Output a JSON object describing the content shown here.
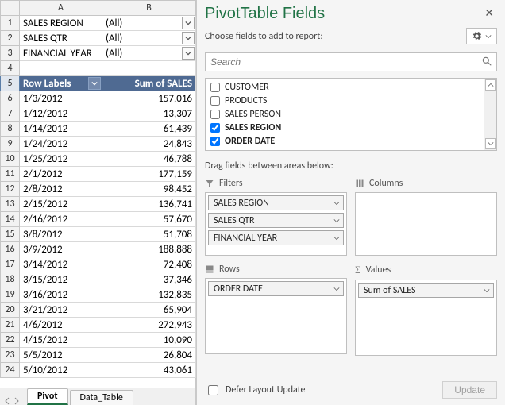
{
  "sheet": {
    "columns": [
      "A",
      "B"
    ],
    "report_filters": [
      {
        "row": 1,
        "label": "SALES REGION",
        "value": "(All)"
      },
      {
        "row": 2,
        "label": "SALES QTR",
        "value": "(All)"
      },
      {
        "row": 3,
        "label": "FINANCIAL YEAR",
        "value": "(All)"
      }
    ],
    "blank_row": 4,
    "header_row": 5,
    "header_labels": {
      "A": "Row Labels",
      "B": "Sum of SALES"
    },
    "data": [
      {
        "row": 6,
        "date": "1/3/2012",
        "value": "157,016"
      },
      {
        "row": 7,
        "date": "1/12/2012",
        "value": "13,307"
      },
      {
        "row": 8,
        "date": "1/14/2012",
        "value": "61,439"
      },
      {
        "row": 9,
        "date": "1/24/2012",
        "value": "24,843"
      },
      {
        "row": 10,
        "date": "1/25/2012",
        "value": "46,788"
      },
      {
        "row": 11,
        "date": "2/1/2012",
        "value": "177,159"
      },
      {
        "row": 12,
        "date": "2/8/2012",
        "value": "98,452"
      },
      {
        "row": 13,
        "date": "2/15/2012",
        "value": "136,741"
      },
      {
        "row": 14,
        "date": "2/16/2012",
        "value": "57,670"
      },
      {
        "row": 15,
        "date": "3/8/2012",
        "value": "51,708"
      },
      {
        "row": 16,
        "date": "3/9/2012",
        "value": "188,888"
      },
      {
        "row": 17,
        "date": "3/14/2012",
        "value": "72,408"
      },
      {
        "row": 18,
        "date": "3/15/2012",
        "value": "37,346"
      },
      {
        "row": 19,
        "date": "3/16/2012",
        "value": "132,835"
      },
      {
        "row": 20,
        "date": "3/21/2012",
        "value": "65,904"
      },
      {
        "row": 21,
        "date": "4/6/2012",
        "value": "272,943"
      },
      {
        "row": 22,
        "date": "4/15/2012",
        "value": "10,090"
      },
      {
        "row": 23,
        "date": "5/5/2012",
        "value": "26,804"
      },
      {
        "row": 24,
        "date": "5/10/2012",
        "value": "43,061"
      }
    ],
    "tabs": [
      {
        "name": "Pivot",
        "active": true
      },
      {
        "name": "Data_Table",
        "active": false
      }
    ]
  },
  "pane": {
    "title": "PivotTable Fields",
    "subtitle": "Choose fields to add to report:",
    "search_placeholder": "Search",
    "fields": [
      {
        "label": "CUSTOMER",
        "checked": false
      },
      {
        "label": "PRODUCTS",
        "checked": false
      },
      {
        "label": "SALES PERSON",
        "checked": false
      },
      {
        "label": "SALES REGION",
        "checked": true
      },
      {
        "label": "ORDER DATE",
        "checked": true
      }
    ],
    "drag_hint": "Drag fields between areas below:",
    "areas": {
      "filters": {
        "label": "Filters",
        "items": [
          "SALES REGION",
          "SALES QTR",
          "FINANCIAL YEAR"
        ]
      },
      "columns": {
        "label": "Columns",
        "items": []
      },
      "rows": {
        "label": "Rows",
        "items": [
          "ORDER DATE"
        ]
      },
      "values": {
        "label": "Values",
        "items": [
          "Sum of SALES"
        ]
      }
    },
    "defer_label": "Defer Layout Update",
    "update_label": "Update"
  }
}
